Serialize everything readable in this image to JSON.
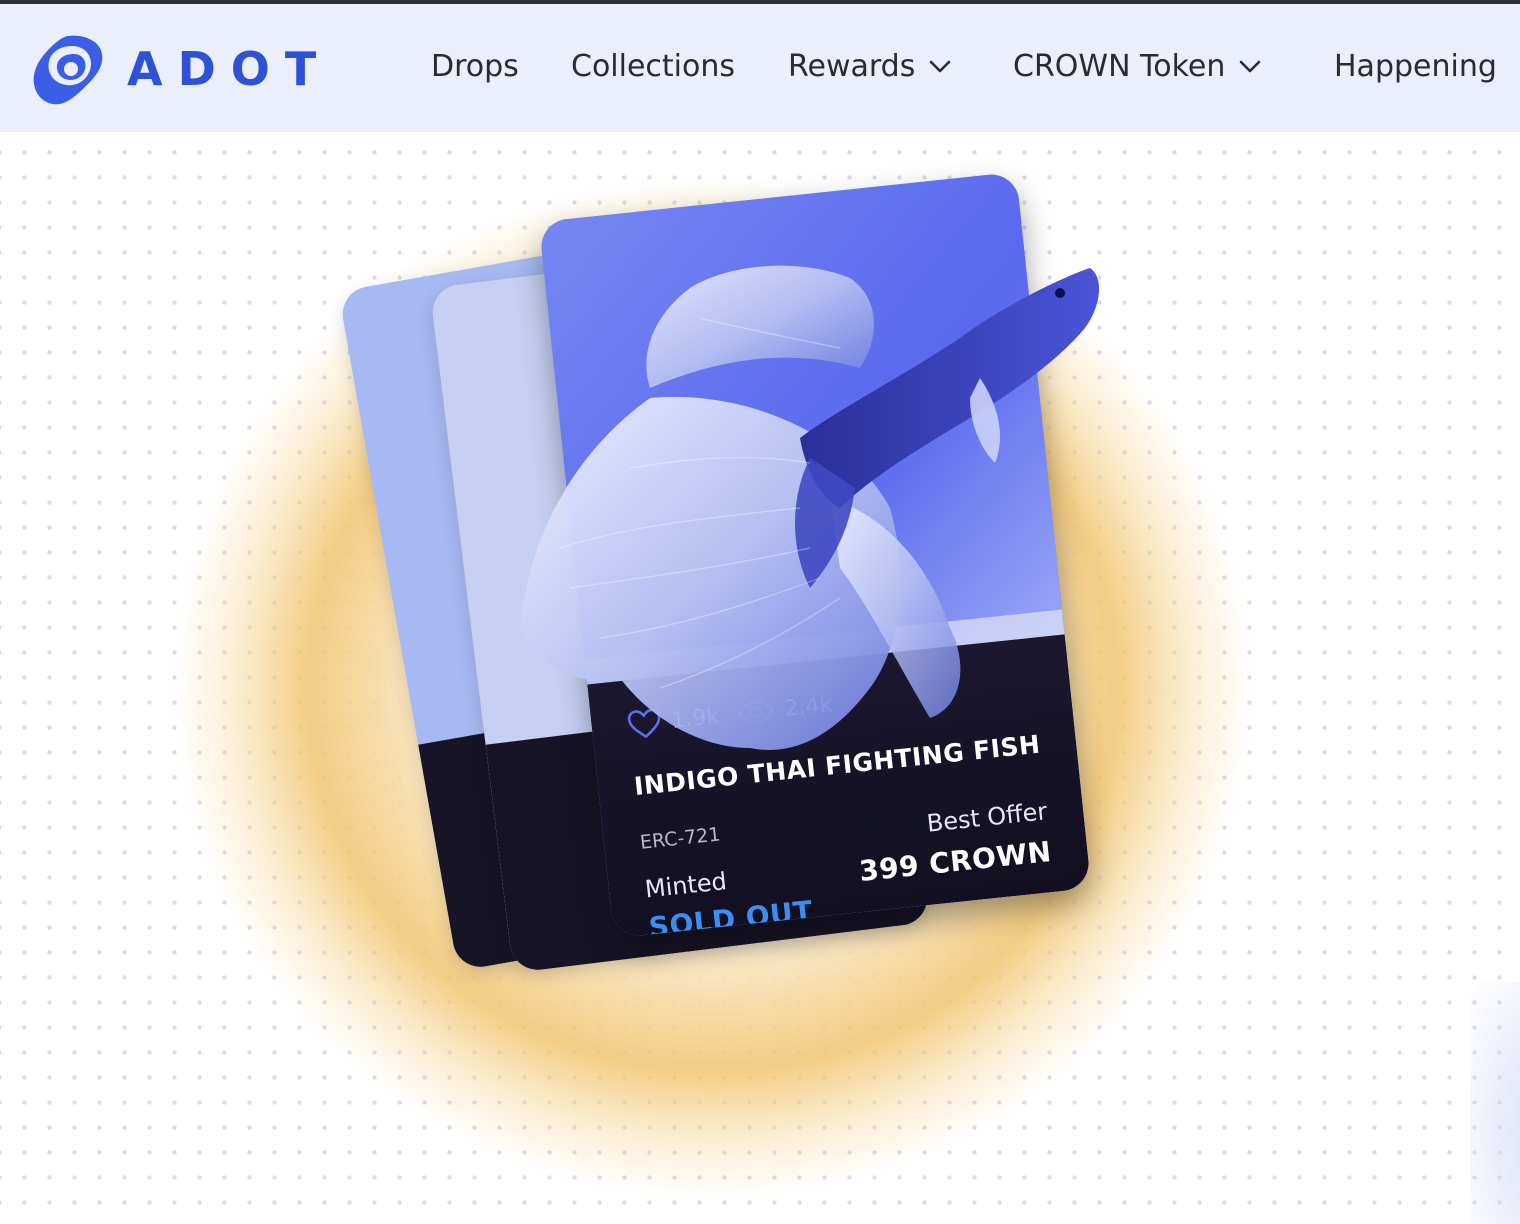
{
  "brand": {
    "name": "ADOT",
    "accent": "#2d52d6"
  },
  "nav": {
    "items": [
      {
        "label": "Drops",
        "has_dropdown": false
      },
      {
        "label": "Collections",
        "has_dropdown": false
      },
      {
        "label": "Rewards",
        "has_dropdown": true
      },
      {
        "label": "CROWN Token",
        "has_dropdown": true
      },
      {
        "label": "Happening",
        "has_dropdown": false
      }
    ]
  },
  "nft_card": {
    "likes": "1.9k",
    "views": "2.4k",
    "title": "INDIGO THAI FIGHTING FISH",
    "standard": "ERC-721",
    "minted_label": "Minted",
    "status": "SOLD OUT",
    "offer_label": "Best Offer",
    "offer_price": "399 CROWN",
    "status_color": "#3b8ef2"
  },
  "icons": [
    "logo-icon",
    "chevron-down-icon",
    "heart-icon",
    "eye-icon"
  ]
}
